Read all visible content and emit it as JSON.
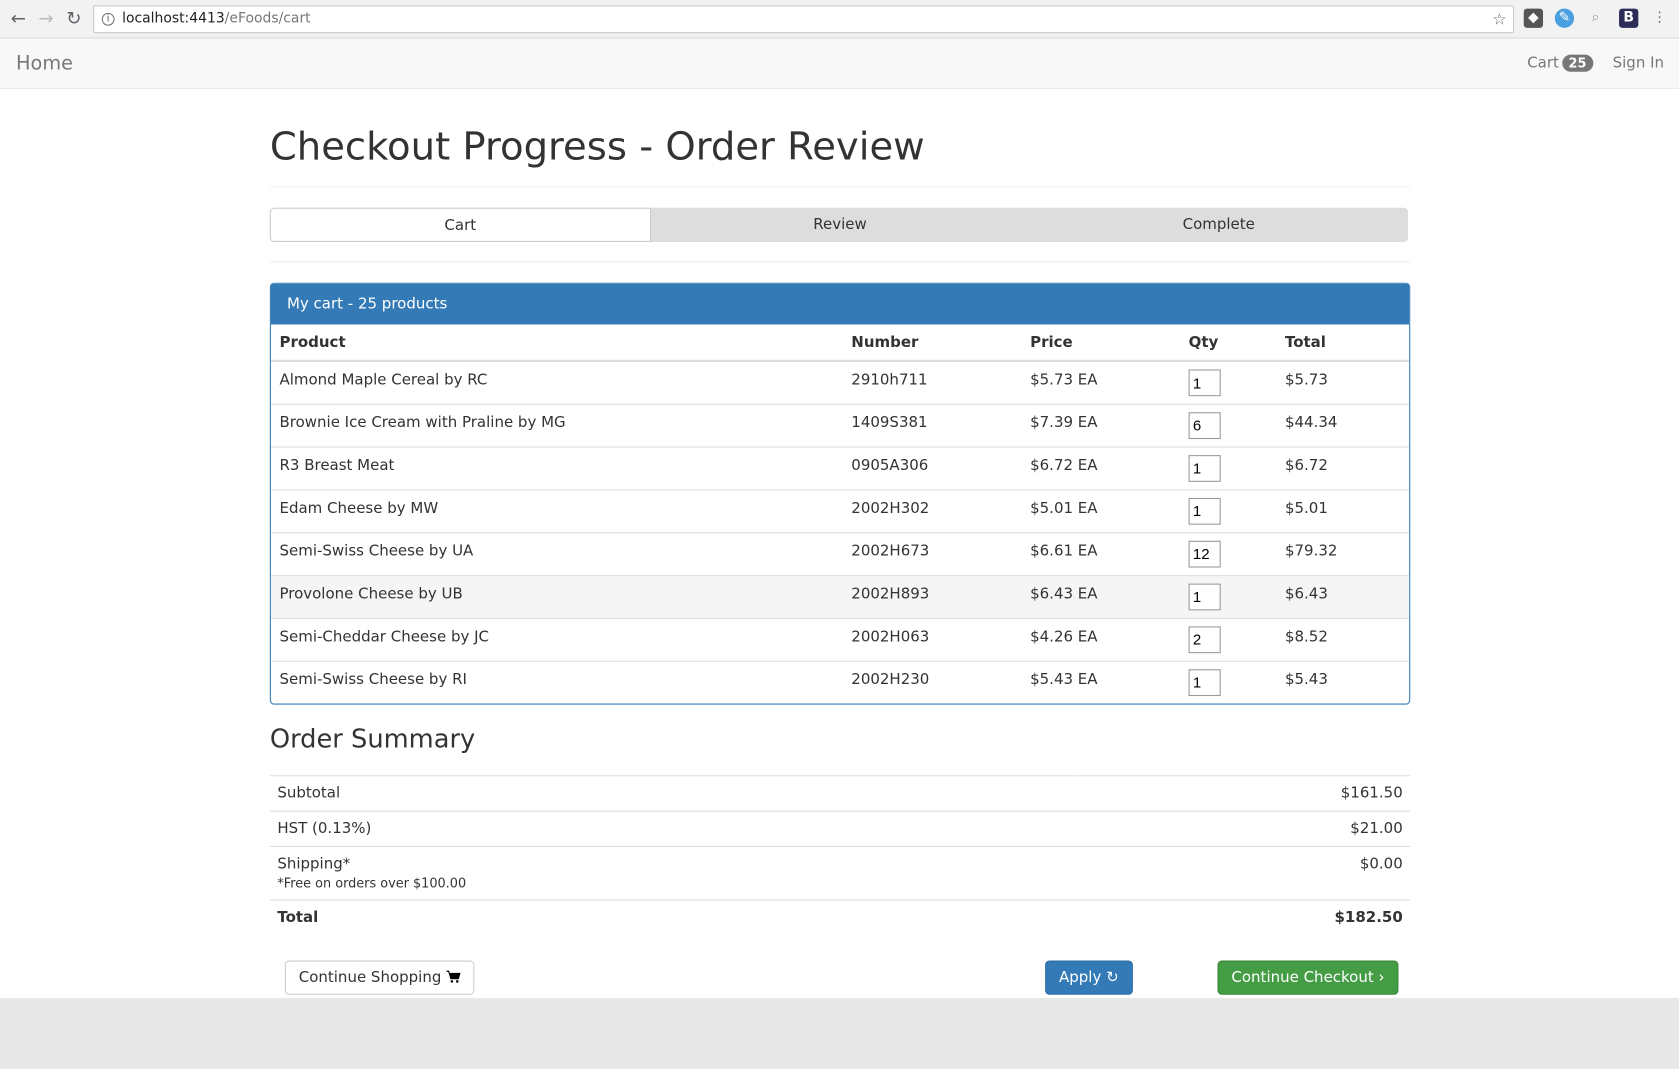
{
  "browser": {
    "url_host": "localhost:4413",
    "url_path": "/eFoods/cart",
    "back_icon": "←",
    "forward_icon": "→",
    "reload_icon": "↻"
  },
  "navbar": {
    "brand": "Home",
    "cart_label": "Cart",
    "cart_count": "25",
    "sign_in": "Sign In"
  },
  "page": {
    "title": "Checkout Progress - Order Review"
  },
  "steps": [
    {
      "label": "Cart",
      "active": true
    },
    {
      "label": "Review",
      "active": false
    },
    {
      "label": "Complete",
      "active": false
    }
  ],
  "cart": {
    "heading": "My cart - 25 products",
    "columns": [
      "Product",
      "Number",
      "Price",
      "Qty",
      "Total"
    ],
    "rows": [
      {
        "product": "Almond Maple Cereal by RC",
        "number": "2910h711",
        "price": "$5.73 EA",
        "qty": "1",
        "total": "$5.73"
      },
      {
        "product": "Brownie Ice Cream with Praline by MG",
        "number": "1409S381",
        "price": "$7.39 EA",
        "qty": "6",
        "total": "$44.34"
      },
      {
        "product": "R3 Breast Meat",
        "number": "0905A306",
        "price": "$6.72 EA",
        "qty": "1",
        "total": "$6.72"
      },
      {
        "product": "Edam Cheese by MW",
        "number": "2002H302",
        "price": "$5.01 EA",
        "qty": "1",
        "total": "$5.01"
      },
      {
        "product": "Semi-Swiss Cheese by UA",
        "number": "2002H673",
        "price": "$6.61 EA",
        "qty": "12",
        "total": "$79.32"
      },
      {
        "product": "Provolone Cheese by UB",
        "number": "2002H893",
        "price": "$6.43 EA",
        "qty": "1",
        "total": "$6.43"
      },
      {
        "product": "Semi-Cheddar Cheese by JC",
        "number": "2002H063",
        "price": "$4.26 EA",
        "qty": "2",
        "total": "$8.52"
      },
      {
        "product": "Semi-Swiss Cheese by RI",
        "number": "2002H230",
        "price": "$5.43 EA",
        "qty": "1",
        "total": "$5.43"
      }
    ]
  },
  "summary": {
    "heading": "Order Summary",
    "subtotal_label": "Subtotal",
    "subtotal": "$161.50",
    "hst_label": "HST (0.13%)",
    "hst": "$21.00",
    "shipping_label": "Shipping*",
    "shipping_note": "*Free on orders over $100.00",
    "shipping": "$0.00",
    "total_label": "Total",
    "total": "$182.50"
  },
  "buttons": {
    "continue_shopping": "Continue Shopping",
    "apply": "Apply",
    "continue_checkout": "Continue Checkout"
  }
}
